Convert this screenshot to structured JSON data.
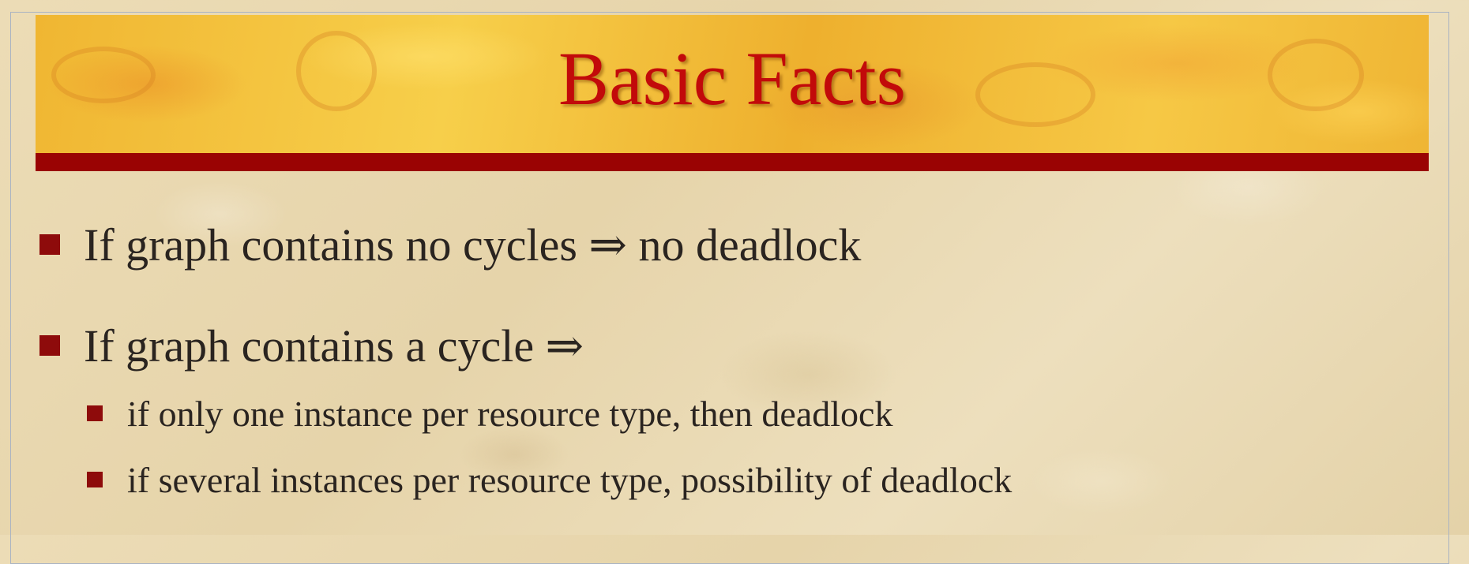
{
  "slide": {
    "title": "Basic Facts",
    "bullets": [
      {
        "text": "If graph contains no cycles ⇒ no deadlock",
        "sub": []
      },
      {
        "text": "If graph contains a cycle ⇒",
        "sub": [
          "if only one instance per resource type, then deadlock",
          "if several instances per resource type, possibility of deadlock"
        ]
      }
    ]
  },
  "colors": {
    "title_text": "#c20a0a",
    "title_rule": "#9a0303",
    "bullet_mark": "#8e0b0b",
    "banner": "#f3c33c",
    "background": "#eadbb4"
  },
  "icons": {
    "bullet": "square-bullet-icon"
  }
}
